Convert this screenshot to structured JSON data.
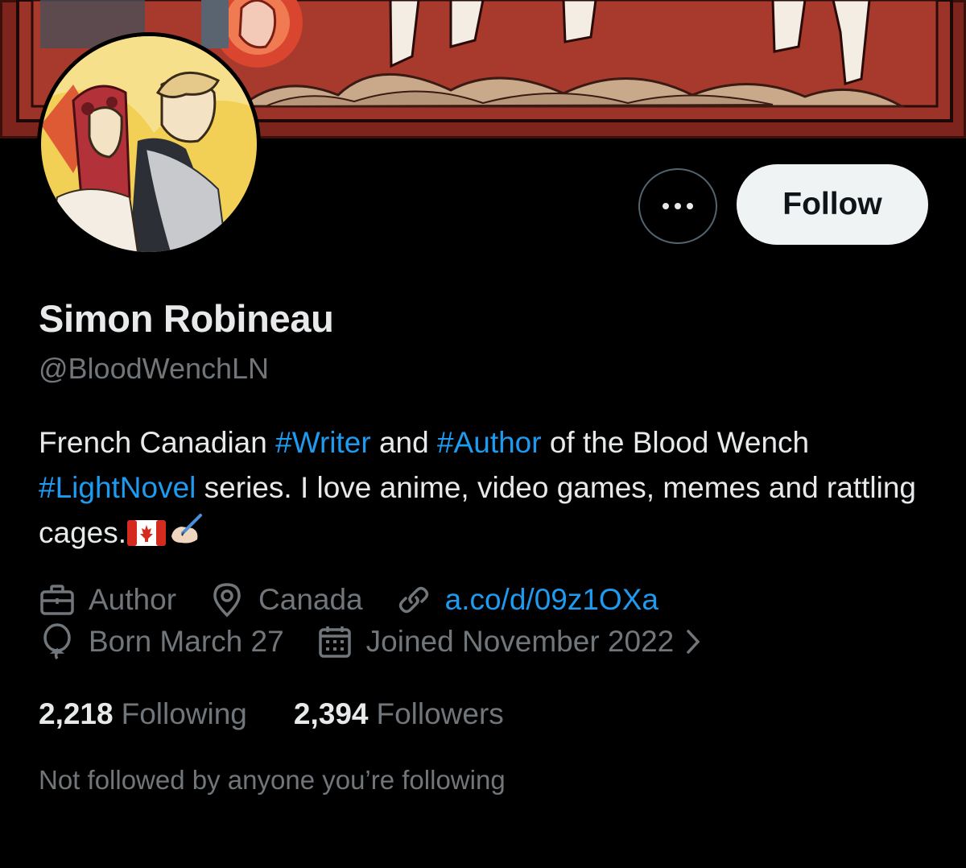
{
  "banner": {
    "alt": "profile banner artwork"
  },
  "avatar": {
    "alt": "profile avatar artwork"
  },
  "actions": {
    "more_icon": "more-horizontal-icon",
    "follow_label": "Follow"
  },
  "profile": {
    "display_name": "Simon Robineau",
    "handle": "@BloodWenchLN",
    "bio": {
      "t1": "French Canadian ",
      "h1": "#Writer",
      "t2": " and ",
      "h2": "#Author",
      "t3": " of the Blood Wench ",
      "h3": "#LightNovel",
      "t4": " series. I love anime, video games, memes and rattling cages.",
      "emoji_1": "🇨🇦",
      "emoji_2": "✍🏻"
    },
    "meta": {
      "profession": "Author",
      "location": "Canada",
      "link": "a.co/d/09z1OXa",
      "birthday": "Born March 27",
      "joined": "Joined November 2022"
    },
    "stats": {
      "following_count": "2,218",
      "following_label": "Following",
      "followers_count": "2,394",
      "followers_label": "Followers"
    },
    "followed_by_note": "Not followed by anyone you’re following"
  },
  "colors": {
    "background": "#000000",
    "accent": "#1d9bf0",
    "secondary_text": "#71767b",
    "follow_button_bg": "#eff3f4"
  },
  "icons": [
    "briefcase-icon",
    "location-pin-icon",
    "link-icon",
    "balloon-icon",
    "calendar-icon",
    "chevron-right-icon"
  ]
}
